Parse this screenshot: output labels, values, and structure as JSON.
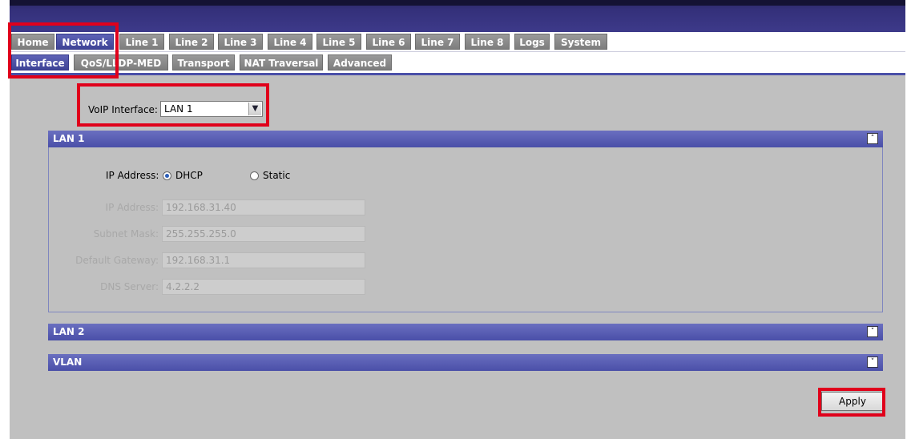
{
  "tabs_top": [
    {
      "label": "Home",
      "active": false
    },
    {
      "label": "Network",
      "active": true
    },
    {
      "label": "Line 1",
      "active": false
    },
    {
      "label": "Line 2",
      "active": false
    },
    {
      "label": "Line 3",
      "active": false
    },
    {
      "label": "Line 4",
      "active": false
    },
    {
      "label": "Line 5",
      "active": false
    },
    {
      "label": "Line 6",
      "active": false
    },
    {
      "label": "Line 7",
      "active": false
    },
    {
      "label": "Line 8",
      "active": false
    },
    {
      "label": "Logs",
      "active": false
    },
    {
      "label": "System",
      "active": false
    }
  ],
  "tabs_sub": [
    {
      "label": "Interface",
      "active": true
    },
    {
      "label": "QoS/LLDP-MED",
      "active": false
    },
    {
      "label": "Transport",
      "active": false
    },
    {
      "label": "NAT Traversal",
      "active": false
    },
    {
      "label": "Advanced",
      "active": false
    }
  ],
  "voip": {
    "label": "VoIP Interface:",
    "value": "LAN 1"
  },
  "lan1": {
    "title": "LAN 1",
    "ip_mode_label": "IP Address:",
    "dhcp_label": "DHCP",
    "static_label": "Static",
    "selected_mode": "DHCP",
    "fields": [
      {
        "label": "IP Address:",
        "value": "192.168.31.40"
      },
      {
        "label": "Subnet Mask:",
        "value": "255.255.255.0"
      },
      {
        "label": "Default Gateway:",
        "value": "192.168.31.1"
      },
      {
        "label": "DNS Server:",
        "value": "4.2.2.2"
      }
    ]
  },
  "lan2": {
    "title": "LAN 2"
  },
  "vlan": {
    "title": "VLAN"
  },
  "apply_label": "Apply",
  "colors": {
    "accent": "#4a4fa8",
    "highlight": "#e0001b",
    "tab_inactive": "#8a8a8a",
    "header_bg": "#2a2460"
  }
}
